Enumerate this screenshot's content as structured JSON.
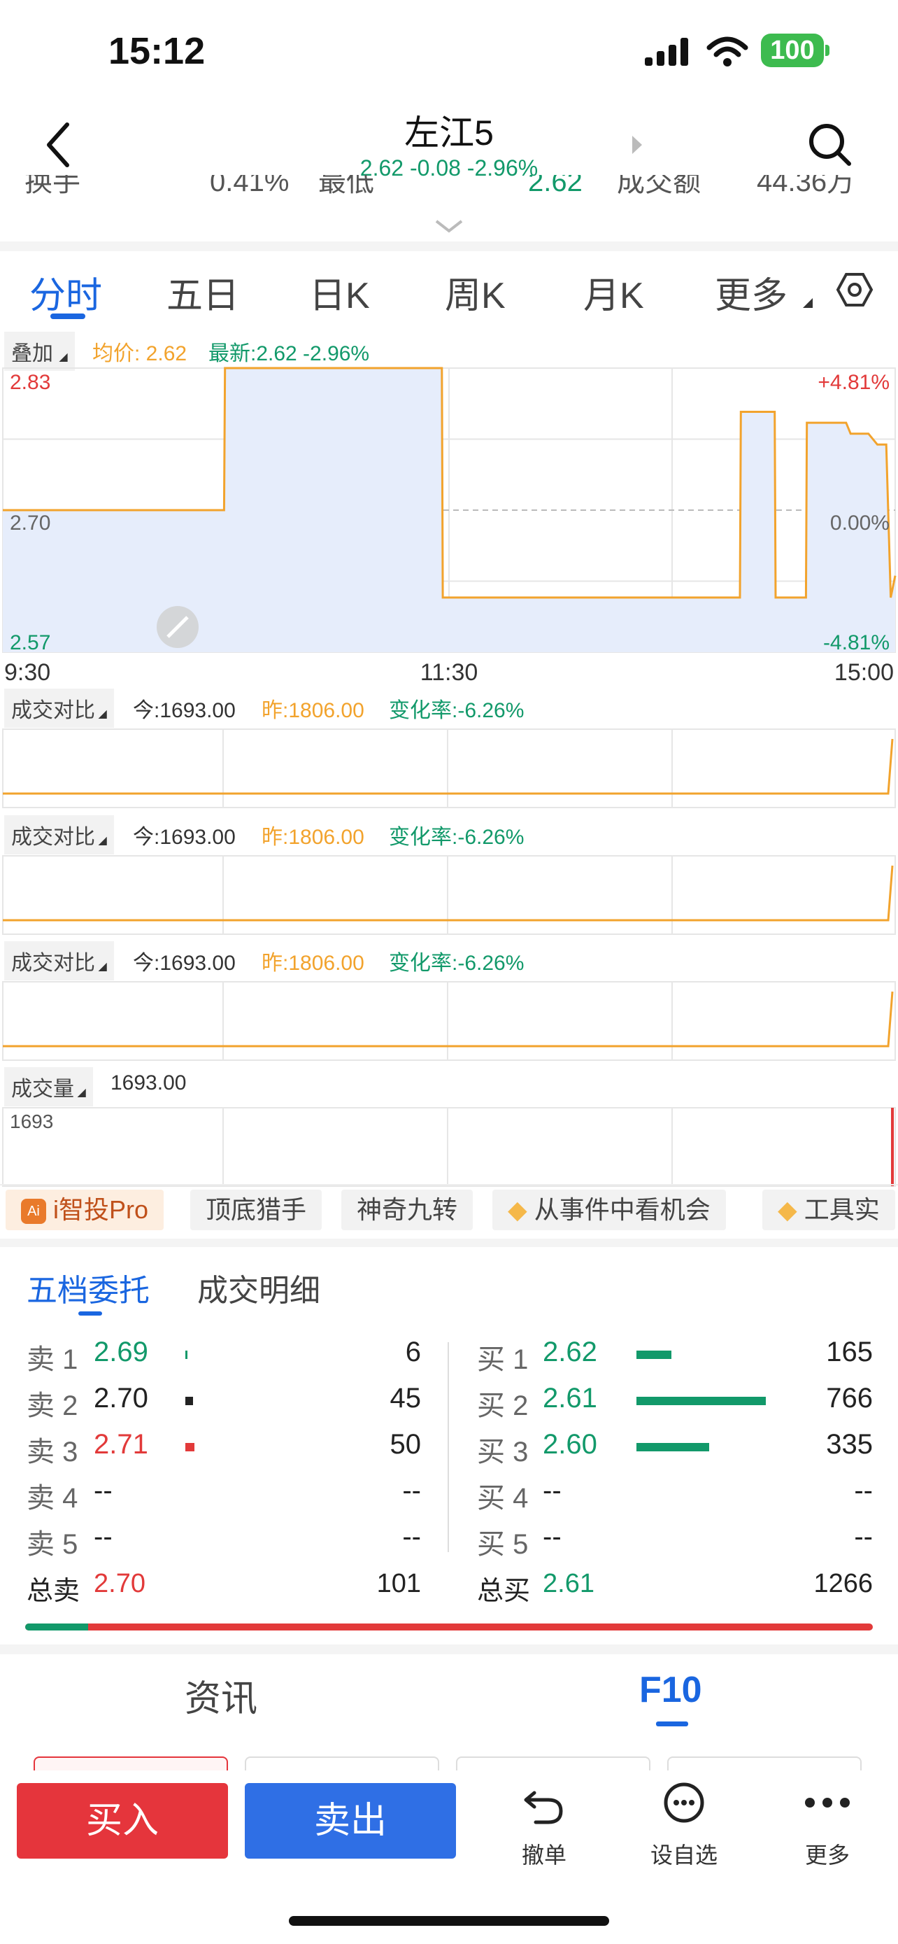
{
  "status": {
    "time": "15:12",
    "battery": "100"
  },
  "header": {
    "title": "左江5",
    "subtitle": "2.62 -0.08 -2.96%",
    "ghost_row": [
      "换手",
      "0.41%",
      "最低",
      "2.62",
      "成交额",
      "44.36万"
    ]
  },
  "tabs": [
    "分时",
    "五日",
    "日K",
    "周K",
    "月K",
    "更多"
  ],
  "chart_header": {
    "overlay": "叠加",
    "avg": "均价: 2.62",
    "latest": "最新:2.62 -2.96%"
  },
  "chart_data": {
    "type": "line",
    "x_ticks": [
      "9:30",
      "11:30",
      "15:00"
    ],
    "y_left_labels": [
      "2.83",
      "2.70",
      "2.57"
    ],
    "y_right_labels": [
      "+4.81%",
      "0.00%",
      "-4.81%"
    ],
    "ylim": [
      2.57,
      2.83
    ],
    "prev_close": 2.7,
    "avg_price": 2.62,
    "price_x": [
      0,
      0.248,
      0.249,
      0.492,
      0.493,
      0.826,
      0.827,
      0.865,
      0.866,
      0.9,
      0.901,
      0.945,
      0.95,
      0.97,
      0.98,
      0.99,
      0.995,
      1.0
    ],
    "price_y": [
      2.7,
      2.7,
      2.83,
      2.83,
      2.62,
      2.62,
      2.79,
      2.79,
      2.62,
      2.62,
      2.78,
      2.78,
      2.77,
      2.77,
      2.76,
      2.76,
      2.62,
      2.64
    ],
    "series": [
      {
        "name": "成交对比",
        "today": "今:1693.00",
        "yesterday": "昨:1806.00",
        "change": "变化率:-6.26%"
      },
      {
        "name": "成交对比",
        "today": "今:1693.00",
        "yesterday": "昨:1806.00",
        "change": "变化率:-6.26%"
      },
      {
        "name": "成交对比",
        "today": "今:1693.00",
        "yesterday": "昨:1806.00",
        "change": "变化率:-6.26%"
      }
    ],
    "volume": {
      "name": "成交量",
      "value": "1693.00",
      "axis_label": "1693"
    }
  },
  "tools": [
    "i智投Pro",
    "顶底猎手",
    "神奇九转",
    "从事件中看机会",
    "工具实"
  ],
  "orderbook": {
    "tabs": [
      "五档委托",
      "成交明细"
    ],
    "sell": [
      {
        "label": "卖 1",
        "price": "2.69",
        "qty": "6",
        "level": 0.01,
        "color": "green"
      },
      {
        "label": "卖 2",
        "price": "2.70",
        "qty": "45",
        "level": 0.06,
        "color": "dark"
      },
      {
        "label": "卖 3",
        "price": "2.71",
        "qty": "50",
        "level": 0.07,
        "color": "red"
      },
      {
        "label": "卖 4",
        "price": "--",
        "qty": "--",
        "level": 0,
        "color": "dark"
      },
      {
        "label": "卖 5",
        "price": "--",
        "qty": "--",
        "level": 0,
        "color": "dark"
      }
    ],
    "buy": [
      {
        "label": "买 1",
        "price": "2.62",
        "qty": "165",
        "level": 0.27,
        "color": "green"
      },
      {
        "label": "买 2",
        "price": "2.61",
        "qty": "766",
        "level": 1.0,
        "color": "green"
      },
      {
        "label": "买 3",
        "price": "2.60",
        "qty": "335",
        "level": 0.56,
        "color": "green"
      },
      {
        "label": "买 4",
        "price": "--",
        "qty": "--",
        "level": 0,
        "color": "dark"
      },
      {
        "label": "买 5",
        "price": "--",
        "qty": "--",
        "level": 0,
        "color": "dark"
      }
    ],
    "total_sell": {
      "label": "总卖",
      "price": "2.70",
      "qty": "101"
    },
    "total_buy": {
      "label": "总买",
      "price": "2.61",
      "qty": "1266"
    },
    "ratio_sell": 0.074
  },
  "bottom_tabs": [
    "资讯",
    "F10"
  ],
  "actions": {
    "buy": "买入",
    "sell": "卖出",
    "cancel": "撤单",
    "watch": "设自选",
    "more": "更多"
  },
  "colors": {
    "green": "#12996a",
    "red": "#e23a3a",
    "orange": "#f2a32d",
    "blue": "#1a66e0"
  }
}
